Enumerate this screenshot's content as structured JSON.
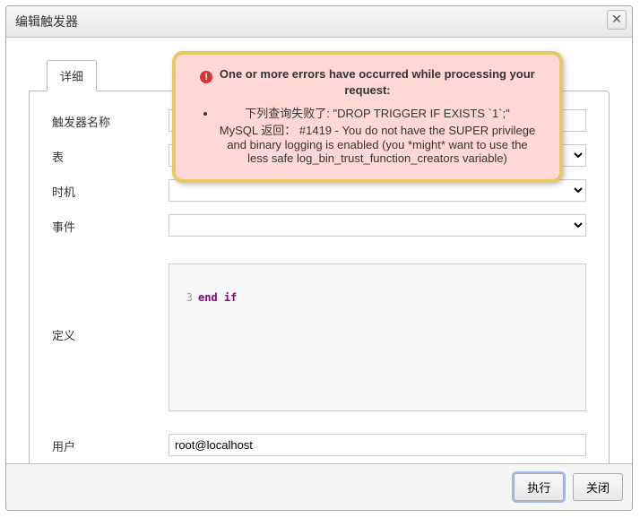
{
  "window": {
    "title": "编辑触发器"
  },
  "tab": {
    "label": "详细"
  },
  "labels": {
    "name": "触发器名称",
    "table": "表",
    "time": "时机",
    "event": "事件",
    "definition": "定义",
    "user": "用户"
  },
  "fields": {
    "name": "",
    "table": "",
    "time": "",
    "event": "",
    "user": "root@localhost"
  },
  "code": {
    "line3_num": "3",
    "line3_text": "end if"
  },
  "buttons": {
    "execute": "执行",
    "close": "关闭"
  },
  "error": {
    "title": "One or more errors have occurred while processing your request:",
    "item1_a": "下列查询失败了: \"DROP TRIGGER IF EXISTS `1`;\"",
    "item1_b": "MySQL 返回： #1419 - You do not have the SUPER privilege and binary logging is enabled (you *might* want to use the less safe log_bin_trust_function_creators variable)"
  }
}
